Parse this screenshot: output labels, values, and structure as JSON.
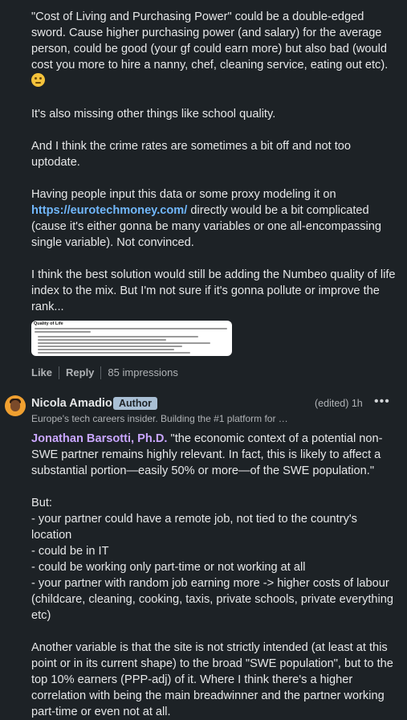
{
  "comment1": {
    "para1": "\"Cost of Living and Purchasing Power\" could be a double-edged sword. Cause higher purchasing power (and salary) for the average person, could be good (your gf could earn more) but also bad (would cost you more to hire a nanny, chef, cleaning service, eating out etc).",
    "para1_emoji": "thinking-face",
    "para2": "It's also missing other things like school quality.",
    "para3": "And I think the crime rates are sometimes a bit off and not too uptodate.",
    "para4_before": "Having people input this data or some proxy modeling it on ",
    "para4_link": "https://eurotechmoney.com/",
    "para4_after": " directly would be a bit complicated (cause it's either gonna be many variables or one all-encompassing single variable). Not convinced.",
    "para5": "I think the best solution would still be adding the Numbeo quality of life index to the mix. But I'm not sure if it's gonna pollute or improve the rank...",
    "image_title": "Quality of Life",
    "actions": {
      "like": "Like",
      "reply": "Reply",
      "impressions": "85 impressions"
    }
  },
  "comment2": {
    "author": "Nicola Amadio",
    "badge": "Author",
    "tagline": "Europe's tech careers insider. Building the #1 platform for …",
    "edited": "(edited) 1h",
    "more_icon": "more-horizontal-icon",
    "mention": "Jonathan Barsotti, Ph.D.",
    "quote": " \"the economic context of a potential non-SWE partner remains highly relevant. In fact, this is likely to affect a substantial portion—easily 50% or more—of the SWE population.\"",
    "but": "But:",
    "bullet1": "- your partner could have a remote job, not tied to the country's location",
    "bullet2": "- could be in IT",
    "bullet3": "- could be working only part-time or not working at all",
    "bullet4": "- your partner with random job earning more -> higher costs of labour (childcare, cleaning, cooking, taxis, private schools, private everything etc)",
    "para_last": "Another variable is that the site is not strictly intended (at least at this point or in its current shape) to the broad \"SWE population\", but to the top 10% earners (PPP-adj) of it. Where I think there's a higher correlation with being the main breadwinner and the partner working part-time or even not at all."
  }
}
